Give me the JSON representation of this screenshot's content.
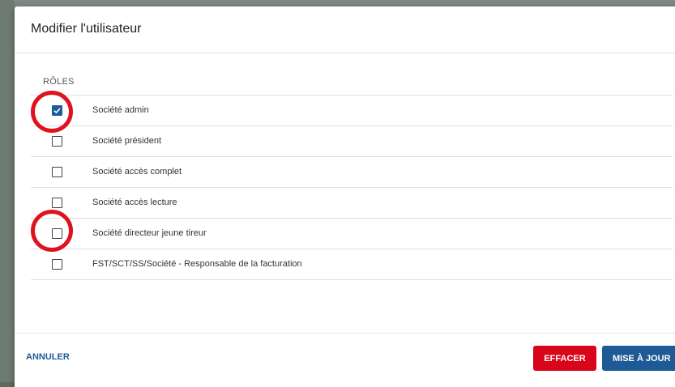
{
  "dialog": {
    "title": "Modifier l'utilisateur"
  },
  "roles": {
    "header": "RÔLES",
    "items": [
      {
        "label": "Société admin",
        "checked": true
      },
      {
        "label": "Société président",
        "checked": false
      },
      {
        "label": "Société accès complet",
        "checked": false
      },
      {
        "label": "Société accès lecture",
        "checked": false
      },
      {
        "label": "Société directeur jeune tireur",
        "checked": false
      },
      {
        "label": "FST/SCT/SS/Société - Responsable de la facturation",
        "checked": false
      }
    ]
  },
  "footer": {
    "cancel_label": "ANNULER",
    "clear_label": "EFFACER",
    "update_label": "MISE À JOUR"
  },
  "colors": {
    "accent": "#1e5a96",
    "danger": "#d9051a",
    "annotation": "#e0121e"
  }
}
